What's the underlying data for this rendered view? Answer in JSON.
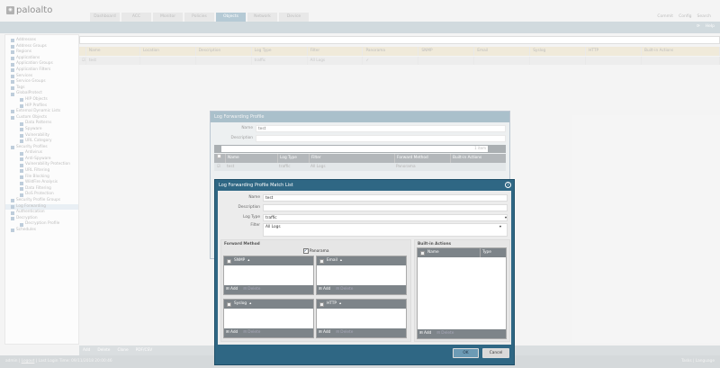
{
  "brand": {
    "logo": "paloalto",
    "sub": "NETWORKS"
  },
  "tabs": [
    "Dashboard",
    "ACC",
    "Monitor",
    "Policies",
    "Objects",
    "Network",
    "Device"
  ],
  "active_tab": "Objects",
  "top_links": [
    "Commit",
    "Config",
    "Search"
  ],
  "band_links": {
    "help": "Help"
  },
  "sidebar": [
    "Addresses",
    "Address Groups",
    "Regions",
    "Applications",
    "Application Groups",
    "Application Filters",
    "Services",
    "Service Groups",
    "Tags",
    "GlobalProtect",
    "HIP Objects",
    "HIP Profiles",
    "External Dynamic Lists",
    "Custom Objects",
    "Data Patterns",
    "Spyware",
    "Vulnerability",
    "URL Category",
    "Security Profiles",
    "Antivirus",
    "Anti-Spyware",
    "Vulnerability Protection",
    "URL Filtering",
    "File Blocking",
    "WildFire Analysis",
    "Data Filtering",
    "DoS Protection",
    "Security Profile Groups",
    "Log Forwarding",
    "Authentication",
    "Decryption",
    "Decryption Profile",
    "Schedules"
  ],
  "sidebar_selected": "Log Forwarding",
  "main_table": {
    "count": "1 item",
    "columns": [
      "Name",
      "Location",
      "Description",
      "Log Type",
      "Filter",
      "Panorama",
      "SNMP",
      "Email",
      "Syslog",
      "HTTP",
      "Built-in Actions"
    ],
    "rows": [
      [
        "test",
        "",
        "",
        "traffic",
        "All Logs",
        "✓",
        "",
        "",
        "",
        "",
        ""
      ]
    ]
  },
  "bottom_toolbar": [
    "Add",
    "Delete",
    "Clone",
    "PDF/CSV"
  ],
  "footer": {
    "user": "admin",
    "logout": "Logout",
    "last_login": "Last Login Time: 09/11/2018 20:00:46",
    "tasks": "Tasks",
    "language": "Language"
  },
  "profile_dialog": {
    "title": "Log Forwarding Profile",
    "name_label": "Name",
    "name": "test",
    "desc_label": "Description",
    "description": "",
    "count": "1 item",
    "columns": [
      "Name",
      "Log Type",
      "Filter",
      "Forward Method",
      "Built-in Actions"
    ],
    "rows": [
      [
        "test",
        "traffic",
        "All Logs",
        "Panorama",
        ""
      ]
    ]
  },
  "match_dialog": {
    "title": "Log Forwarding Profile Match List",
    "name_label": "Name",
    "name": "test",
    "desc_label": "Description",
    "description": "",
    "logtype_label": "Log Type",
    "log_type": "traffic",
    "filter_label": "Filter",
    "filter": "All Logs",
    "forward_method": "Forward Method",
    "panorama": "Panorama",
    "panorama_checked": true,
    "grids": [
      "SNMP",
      "Email",
      "Syslog",
      "HTTP"
    ],
    "add": "Add",
    "delete": "Delete",
    "builtin": "Built-in Actions",
    "builtin_cols": [
      "Name",
      "Type"
    ],
    "ok": "OK",
    "cancel": "Cancel"
  }
}
